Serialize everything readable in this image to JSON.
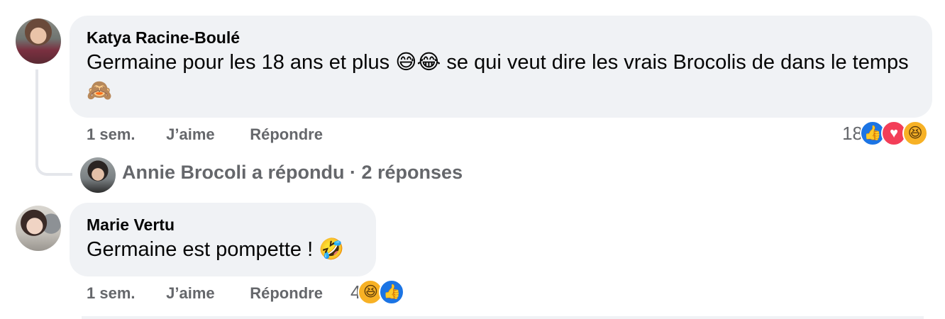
{
  "comments": [
    {
      "author": "Katya Racine-Boulé",
      "text": "Germaine pour les 18 ans et plus 😅😂 se qui veut dire les vrais Brocolis de dans le temps 🙈",
      "time": "1 sem.",
      "like_label": "J’aime",
      "reply_label": "Répondre",
      "reaction_count": "18",
      "reactions": [
        "like-icon",
        "love-icon",
        "haha-icon"
      ]
    },
    {
      "author": "Marie Vertu",
      "text": "Germaine est pompette ! 🤣",
      "time": "1 sem.",
      "like_label": "J’aime",
      "reply_label": "Répondre",
      "reaction_count": "4",
      "reactions": [
        "haha-icon",
        "like-icon"
      ]
    }
  ],
  "replies_summary": "Annie Brocoli a répondu · 2 réponses",
  "colors": {
    "bubble": "#f0f2f5",
    "secondary_text": "#65676b",
    "like": "#1b74e4",
    "love": "#f33e58",
    "haha": "#f7b125"
  }
}
